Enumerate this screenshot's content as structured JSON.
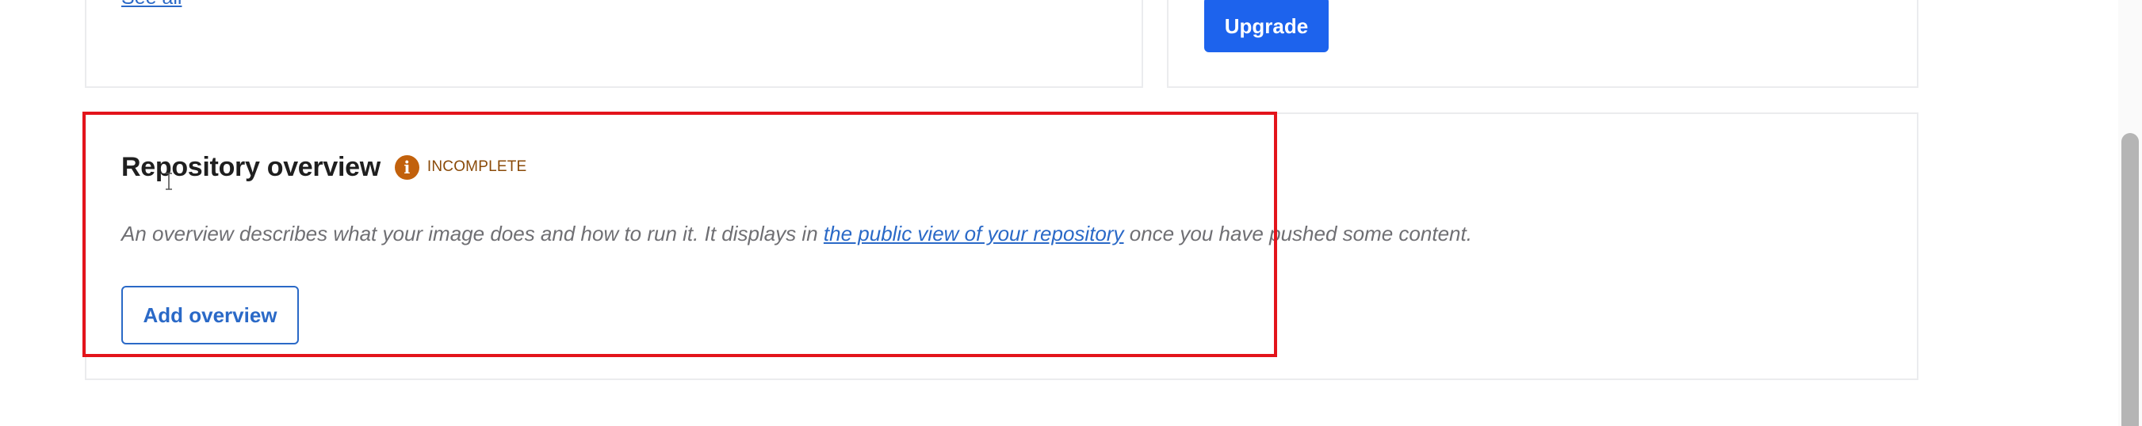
{
  "top_left_card": {
    "see_all_label": "See all"
  },
  "top_right_card": {
    "upgrade_label": "Upgrade"
  },
  "overview": {
    "title": "Repository overview",
    "status_badge": "INCOMPLETE",
    "info_icon": "info-icon",
    "description_before": "An overview describes what your image does and how to run it. It displays in ",
    "description_link": "the public view of your repository",
    "description_after": " once you have pushed some content.",
    "add_button_label": "Add overview"
  },
  "colors": {
    "primary_blue": "#1d63ed",
    "link_blue": "#2a69c7",
    "warning_orange": "#c2610c",
    "highlight_red": "#e3141b"
  }
}
